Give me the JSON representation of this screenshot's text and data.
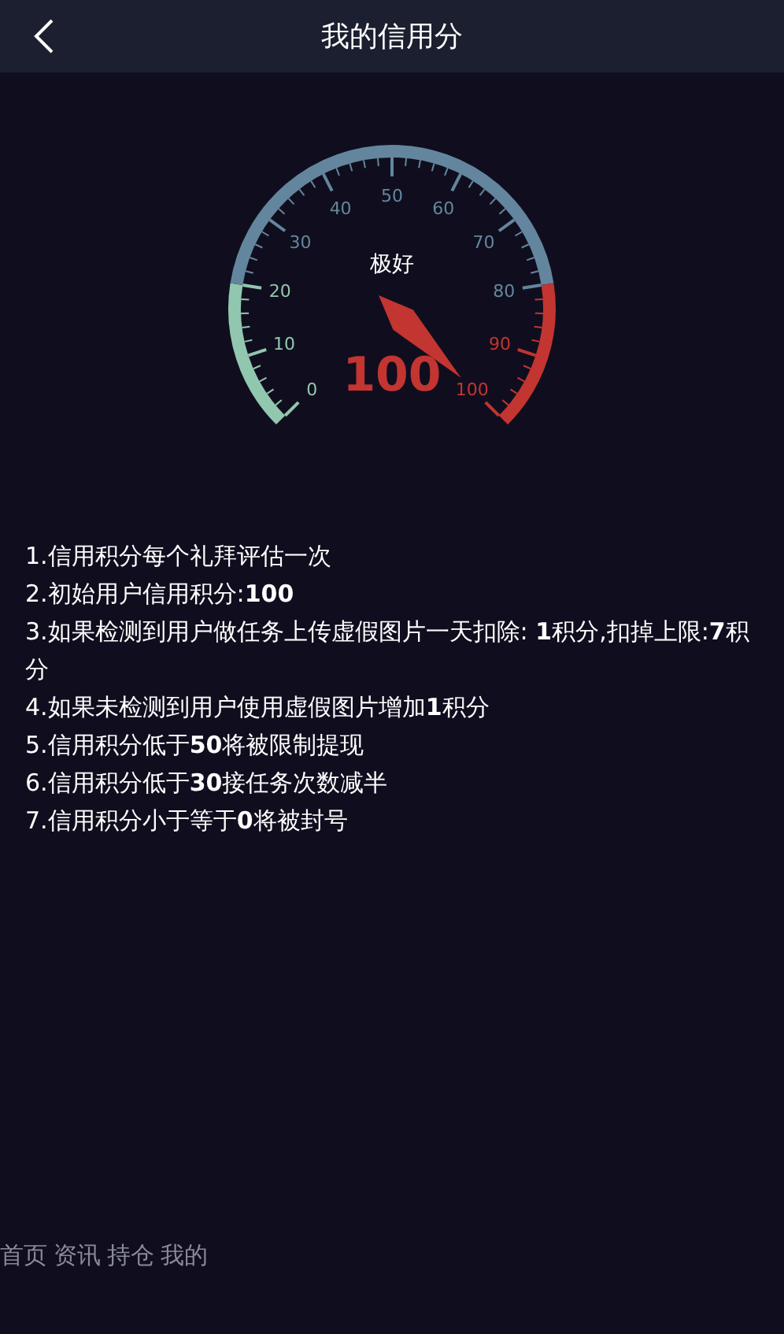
{
  "header": {
    "title": "我的信用分"
  },
  "gauge": {
    "label": "极好",
    "value": "100",
    "ticks": [
      "0",
      "10",
      "20",
      "30",
      "40",
      "50",
      "60",
      "70",
      "80",
      "90",
      "100"
    ],
    "segments": [
      {
        "color": "#91c7ae"
      },
      {
        "color": "#63869e"
      },
      {
        "color": "#c23531"
      }
    ]
  },
  "rules": [
    "1.信用积分每个礼拜评估一次",
    "2.初始用户信用积分:**100**",
    "3.如果检测到用户做任务上传虚假图片一天扣除: **1**积分,扣掉上限:**7**积分",
    "4.如果未检测到用户使用虚假图片增加**1**积分",
    "5.信用积分低于**50**将被限制提现",
    "6.信用积分低于**30**接任务次数减半",
    "7.信用积分小于等于**0**将被封号"
  ],
  "nav": [
    "首页",
    "资讯",
    "持仓",
    "我的"
  ]
}
